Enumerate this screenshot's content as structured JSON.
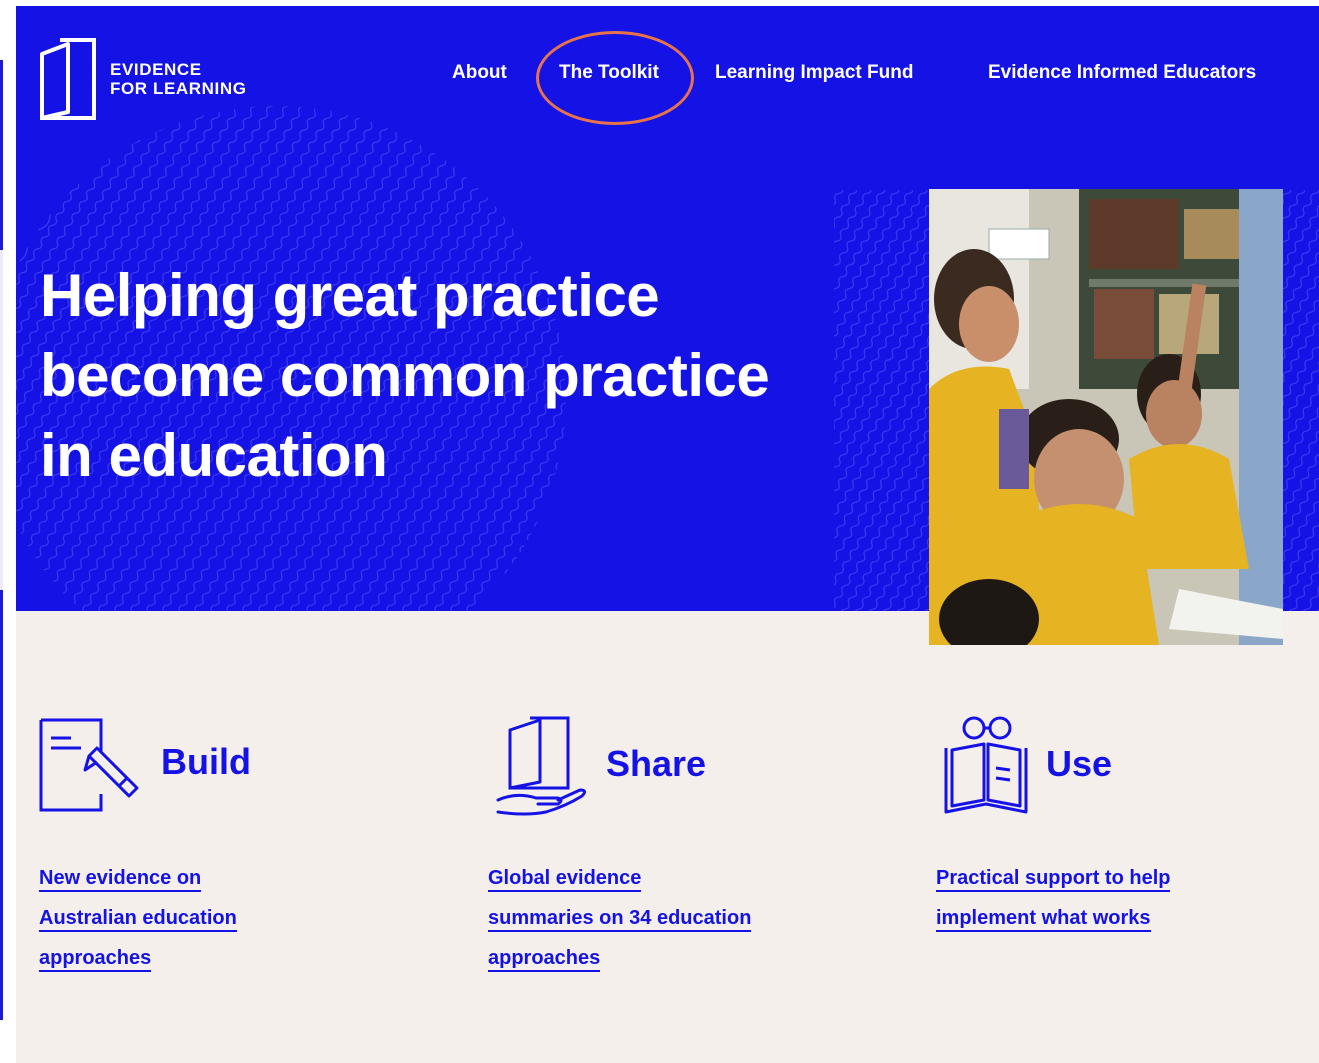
{
  "brand": {
    "logo_line1": "EVIDENCE",
    "logo_line2": "FOR LEARNING",
    "primary_color": "#1512e6",
    "background_cream": "#f4efea",
    "highlight_color": "#e8734a"
  },
  "nav": {
    "items": [
      {
        "label": "About"
      },
      {
        "label": "The Toolkit",
        "highlighted": true
      },
      {
        "label": "Learning Impact Fund"
      },
      {
        "label": "Evidence Informed Educators"
      }
    ]
  },
  "hero": {
    "title": "Helping great practice become common practice in education",
    "image": "classroom-students-raising-hands"
  },
  "features": [
    {
      "icon": "document-pencil-icon",
      "title": "Build",
      "link_lines": [
        "New evidence on",
        "Australian education",
        "approaches"
      ]
    },
    {
      "icon": "book-in-hand-icon",
      "title": "Share",
      "link_lines": [
        "Global evidence",
        "summaries on 34 education",
        "approaches"
      ]
    },
    {
      "icon": "reading-glasses-book-icon",
      "title": "Use",
      "link_lines": [
        "Practical support to help",
        "implement what works"
      ]
    }
  ]
}
